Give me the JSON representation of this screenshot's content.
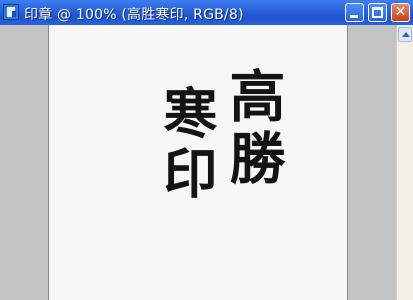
{
  "window": {
    "title": "印章 @ 100% (高胜寒印, RGB/8)",
    "icon": "document-image-icon"
  },
  "controls": {
    "minimize": "minimize-icon",
    "maximize": "maximize-icon",
    "close_label": "✕"
  },
  "seal": {
    "column_right": "高勝",
    "column_left": "寒印"
  },
  "colors": {
    "titlebar": "#2a63db",
    "canvas_bg": "#f7f7f7",
    "surround_bg": "#c3c3c3",
    "ink": "#141414"
  }
}
